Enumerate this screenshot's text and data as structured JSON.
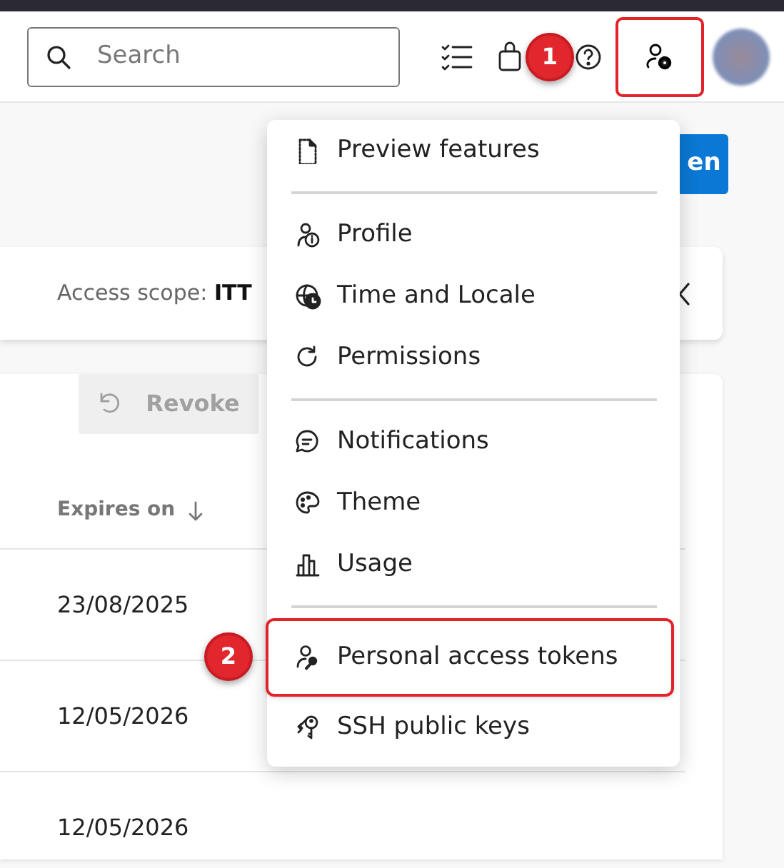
{
  "header": {
    "search": {
      "placeholder": "Search"
    },
    "settings_button": {
      "highlighted": true
    }
  },
  "new_token_button": {
    "label": "en"
  },
  "scope_bar": {
    "text": "Access scope: **ITT**"
  },
  "toolbar": {
    "revoke": {
      "label": "Revoke",
      "disabled": true
    }
  },
  "table": {
    "columns": [
      {
        "label": "Expires on"
      }
    ],
    "rows": [
      {
        "expires_on": "23/08/2025"
      },
      {
        "expires_on": "12/05/2026"
      },
      {
        "expires_on": "12/05/2026"
      }
    ]
  },
  "user_menu": {
    "items": [
      {
        "kind": "item",
        "label": "Preview features",
        "highlighted": false
      },
      {
        "kind": "divider"
      },
      {
        "kind": "item",
        "label": "Profile",
        "highlighted": false
      },
      {
        "kind": "item",
        "label": "Time and Locale",
        "highlighted": false
      },
      {
        "kind": "item",
        "label": "Permissions",
        "highlighted": false
      },
      {
        "kind": "divider"
      },
      {
        "kind": "item",
        "label": "Notifications",
        "highlighted": false
      },
      {
        "kind": "item",
        "label": "Theme",
        "highlighted": false
      },
      {
        "kind": "item",
        "label": "Usage",
        "highlighted": false
      },
      {
        "kind": "divider"
      },
      {
        "kind": "item",
        "label": "Personal access tokens",
        "highlighted": true
      },
      {
        "kind": "item",
        "label": "SSH public keys",
        "highlighted": false
      }
    ]
  },
  "annotations": [
    {
      "label": "1"
    },
    {
      "label": "2"
    }
  ]
}
